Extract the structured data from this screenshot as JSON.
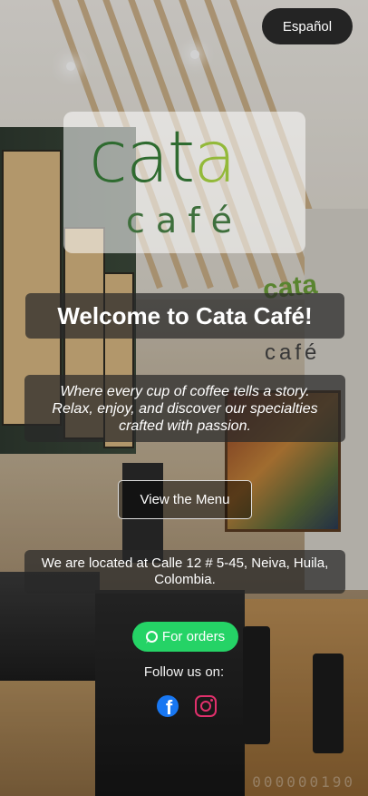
{
  "language_button": {
    "label": "Español"
  },
  "logo": {
    "word_part1": "cat",
    "word_part2": "a",
    "subtitle": "café"
  },
  "hero": {
    "title": "Welcome to Cata Café!",
    "tagline": "Where every cup of coffee tells a story. Relax, enjoy, and discover our specialties crafted with passion."
  },
  "menu_button": {
    "label": "View the Menu"
  },
  "location": {
    "text": "We are located at Calle 12 # 5-45, Neiva, Huila, Colombia."
  },
  "orders_button": {
    "label": "For orders",
    "icon": "whatsapp-icon"
  },
  "social": {
    "label": "Follow us on:",
    "links": [
      {
        "icon": "facebook-icon",
        "color": "#1877f2"
      },
      {
        "icon": "instagram-icon",
        "color": "#e1306c"
      }
    ]
  },
  "background": {
    "wall_sign_word": "cata",
    "wall_sign_sub": "café",
    "counter_readout": "000000190"
  },
  "colors": {
    "whatsapp_green": "#25d366",
    "dark_panel": "#242424",
    "logo_dark_green": "#2f6b30",
    "logo_light_green": "#93b93a"
  }
}
